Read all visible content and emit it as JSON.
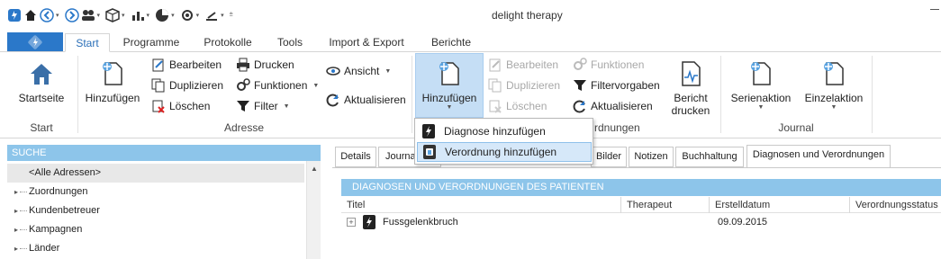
{
  "window": {
    "title": "delight therapy"
  },
  "tabs": [
    {
      "label": "Start"
    },
    {
      "label": "Programme"
    },
    {
      "label": "Protokolle"
    },
    {
      "label": "Tools"
    },
    {
      "label": "Import & Export"
    },
    {
      "label": "Berichte"
    }
  ],
  "ribbon": {
    "start_group": {
      "label": "Start",
      "startseite": "Startseite"
    },
    "adresse_group": {
      "label": "Adresse",
      "hinzufuegen": "Hinzufügen",
      "bearbeiten": "Bearbeiten",
      "duplizieren": "Duplizieren",
      "loeschen": "Löschen",
      "drucken": "Drucken",
      "funktionen": "Funktionen",
      "filter": "Filter",
      "ansicht": "Ansicht",
      "aktualisieren": "Aktualisieren"
    },
    "zuordnungen_group": {
      "label": "Zuordnungen",
      "visible_label": "rdnungen",
      "hinzufuegen": "Hinzufügen",
      "bearbeiten": "Bearbeiten",
      "duplizieren": "Duplizieren",
      "loeschen": "Löschen",
      "funktionen": "Funktionen",
      "filtervorgaben": "Filtervorgaben",
      "aktualisieren": "Aktualisieren",
      "bericht_line1": "Bericht",
      "bericht_line2": "drucken"
    },
    "journal_group": {
      "label": "Journal",
      "serienaktion": "Serienaktion",
      "einzelaktion": "Einzelaktion"
    }
  },
  "dropdown": {
    "items": [
      {
        "label": "Diagnose hinzufügen"
      },
      {
        "label": "Verordnung hinzufügen"
      }
    ]
  },
  "search_panel": {
    "header": "SUCHE",
    "items": [
      {
        "label": "<Alle Adressen>"
      },
      {
        "label": "Zuordnungen"
      },
      {
        "label": "Kundenbetreuer"
      },
      {
        "label": "Kampagnen"
      },
      {
        "label": "Länder"
      }
    ]
  },
  "detail_tabs": {
    "tabs": [
      {
        "label": "Details"
      },
      {
        "label": "Journal"
      },
      {
        "label": "Bilder"
      },
      {
        "label": "Notizen"
      },
      {
        "label": "Buchhaltung"
      },
      {
        "label": "Diagnosen und Verordnungen"
      }
    ]
  },
  "diagnosen_panel": {
    "header": "DIAGNOSEN UND VERORDNUNGEN DES PATIENTEN",
    "columns": [
      "Titel",
      "Therapeut",
      "Erstelldatum",
      "Verordnungsstatus"
    ],
    "rows": [
      {
        "titel": "Fussgelenkbruch",
        "therapeut": "",
        "erstelldatum": "09.09.2015",
        "status": ""
      }
    ]
  },
  "colors": {
    "accent": "#2b78c9",
    "panel_header": "#8dc5ea",
    "highlight": "#d6e8f9"
  }
}
